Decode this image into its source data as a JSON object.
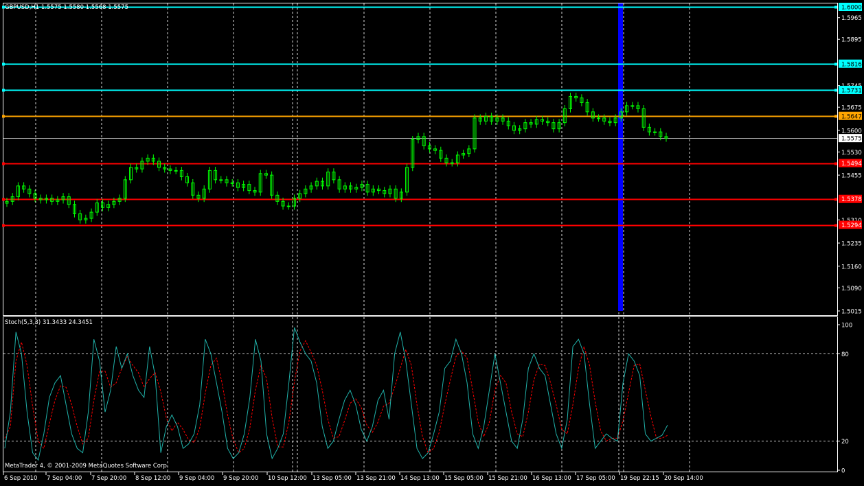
{
  "header": {
    "symbol_info": "GBPUSD,H1  1.5575 1.5580 1.5568 1.5575",
    "indicator_info": "Stoch(5,3,3) 31.3433 24.3451",
    "copyright": "MetaTrader 4, © 2001-2009 MetaQuotes Software Corp."
  },
  "colors": {
    "background": "#000000",
    "frame": "#ffffff",
    "grid": "#ffffff",
    "bull_candle": "#00ff00",
    "resistance_line": "#00ffff",
    "pivot_line": "#ffa500",
    "support_line": "#ff0000",
    "bid_line": "#c0c0c0",
    "highlight_bar": "#0000ff",
    "stoch_main": "#20b2aa",
    "stoch_signal": "#ff0000"
  },
  "price_axis": {
    "ticks": [
      "1.5965",
      "1.5895",
      "1.5745",
      "1.5675",
      "1.5600",
      "1.5530",
      "1.5455",
      "1.5310",
      "1.5235",
      "1.5160",
      "1.5090",
      "1.5015"
    ]
  },
  "price_tags": [
    {
      "label": "1.6000",
      "kind": "resistance"
    },
    {
      "label": "1.5816",
      "kind": "resistance"
    },
    {
      "label": "1.5731",
      "kind": "resistance"
    },
    {
      "label": "1.5647",
      "kind": "pivot"
    },
    {
      "label": "1.5575",
      "kind": "bid"
    },
    {
      "label": "1.5494",
      "kind": "support"
    },
    {
      "label": "1.5378",
      "kind": "support"
    },
    {
      "label": "1.5294",
      "kind": "support"
    }
  ],
  "time_axis": {
    "labels": [
      "6 Sep 2010",
      "7 Sep 04:00",
      "7 Sep 20:00",
      "8 Sep 12:00",
      "9 Sep 04:00",
      "9 Sep 20:00",
      "10 Sep 12:00",
      "13 Sep 05:00",
      "13 Sep 21:00",
      "14 Sep 13:00",
      "15 Sep 05:00",
      "15 Sep 21:00",
      "16 Sep 13:00",
      "17 Sep 05:00",
      "19 Sep 22:15",
      "20 Sep 14:00"
    ]
  },
  "stoch_axis": {
    "ticks": [
      "100",
      "80",
      "20",
      "0"
    ]
  },
  "chart_data": [
    {
      "type": "candlestick",
      "title": "GBPUSD,H1  1.5575 1.5580 1.5568 1.5575",
      "ylim": [
        1.5015,
        1.6
      ],
      "price_levels": [
        1.6,
        1.5816,
        1.5731,
        1.5647,
        1.5575,
        1.5494,
        1.5378,
        1.5294
      ],
      "series": [
        {
          "values": [
            1.537,
            1.5385,
            1.542,
            1.541,
            1.5395,
            1.538,
            1.5375,
            1.538,
            1.537,
            1.5375,
            1.5385,
            1.536,
            1.533,
            1.531,
            1.5315,
            1.5335,
            1.5365,
            1.535,
            1.536,
            1.537,
            1.538,
            1.544,
            1.548,
            1.5475,
            1.55,
            1.551,
            1.55,
            1.548,
            1.5475,
            1.547,
            1.547,
            1.545,
            1.543,
            1.539,
            1.538,
            1.541,
            1.547,
            1.544,
            1.544,
            1.543,
            1.543,
            1.5415,
            1.5425,
            1.5405,
            1.54,
            1.546,
            1.5455,
            1.539,
            1.537,
            1.5355,
            1.5355,
            1.538,
            1.5395,
            1.541,
            1.542,
            1.5435,
            1.542,
            1.5465,
            1.544,
            1.541,
            1.542,
            1.541,
            1.5415,
            1.5425,
            1.54,
            1.541,
            1.5405,
            1.5395,
            1.541,
            1.538,
            1.54,
            1.548,
            1.557,
            1.558,
            1.555,
            1.554,
            1.5535,
            1.551,
            1.5495,
            1.5495,
            1.552,
            1.5525,
            1.554,
            1.564,
            1.563,
            1.5645,
            1.563,
            1.564,
            1.563,
            1.5615,
            1.56,
            1.5605,
            1.5625,
            1.562,
            1.5635,
            1.563,
            1.5625,
            1.5605,
            1.5625,
            1.567,
            1.571,
            1.5705,
            1.569,
            1.566,
            1.564,
            1.564,
            1.563,
            1.5625,
            1.564,
            1.566,
            1.568,
            1.568,
            1.567,
            1.561,
            1.5595,
            1.5595,
            1.558,
            1.5575
          ]
        }
      ]
    },
    {
      "type": "line",
      "title": "Stoch(5,3,3) 31.3433 24.3451",
      "ylim": [
        0,
        100
      ],
      "levels": [
        80,
        20
      ],
      "series": [
        {
          "values": [
            15,
            40,
            95,
            80,
            40,
            12,
            7,
            25,
            50,
            60,
            65,
            45,
            25,
            15,
            12,
            40,
            90,
            75,
            40,
            55,
            85,
            70,
            80,
            65,
            55,
            50,
            85,
            65,
            12,
            30,
            38,
            30,
            15,
            18,
            25,
            45,
            90,
            80,
            60,
            40,
            15,
            8,
            12,
            25,
            50,
            90,
            75,
            25,
            8,
            15,
            25,
            60,
            98,
            88,
            80,
            75,
            60,
            30,
            15,
            20,
            35,
            48,
            55,
            45,
            28,
            20,
            30,
            48,
            55,
            35,
            80,
            95,
            75,
            45,
            15,
            8,
            12,
            25,
            40,
            70,
            75,
            90,
            80,
            60,
            25,
            15,
            30,
            55,
            80,
            60,
            40,
            20,
            15,
            35,
            70,
            80,
            70,
            65,
            45,
            25,
            15,
            35,
            85,
            90,
            80,
            45,
            15,
            20,
            25,
            22,
            20,
            60,
            80,
            75,
            65,
            25,
            20,
            22,
            24,
            31
          ]
        },
        {
          "values": [
            22,
            30,
            75,
            88,
            72,
            44,
            20,
            15,
            32,
            48,
            58,
            57,
            45,
            30,
            18,
            22,
            48,
            68,
            68,
            57,
            60,
            70,
            78,
            72,
            67,
            57,
            63,
            67,
            54,
            36,
            27,
            33,
            28,
            21,
            19,
            29,
            53,
            72,
            77,
            60,
            38,
            21,
            12,
            15,
            29,
            55,
            72,
            63,
            36,
            16,
            16,
            33,
            61,
            82,
            89,
            81,
            72,
            55,
            35,
            22,
            23,
            34,
            46,
            49,
            43,
            31,
            26,
            33,
            44,
            46,
            57,
            70,
            83,
            72,
            45,
            23,
            12,
            15,
            26,
            45,
            62,
            78,
            82,
            77,
            55,
            33,
            23,
            33,
            55,
            65,
            60,
            40,
            25,
            23,
            40,
            62,
            73,
            72,
            60,
            45,
            28,
            25,
            45,
            70,
            85,
            72,
            47,
            27,
            20,
            22,
            22,
            34,
            53,
            72,
            73,
            55,
            37,
            22,
            22,
            24
          ]
        }
      ]
    }
  ]
}
